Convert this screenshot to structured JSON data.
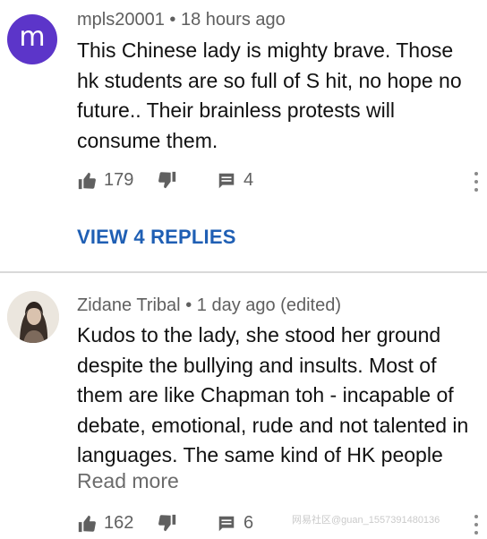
{
  "comments": [
    {
      "avatar_letter": "m",
      "avatar_color": "#5c35c9",
      "author": "mpls20001",
      "time": "18 hours ago",
      "text": "This Chinese lady is mighty brave. Those hk students are so full of S hit, no hope no future.. Their brainless protests will consume them.",
      "likes": "179",
      "replies": "4",
      "view_replies_label": "VIEW 4 REPLIES"
    },
    {
      "avatar_icon": "profile-photo",
      "author": "Zidane Tribal",
      "time": "1 day ago (edited)",
      "text": "Kudos to the lady, she stood her ground despite the bullying and insults. Most of them are like Chapman toh - incapable of debate, emotional, rude and not talented in languages. The same kind of HK people",
      "read_more_label": "Read more",
      "likes": "162",
      "replies": "6"
    }
  ],
  "meta_separator": "•",
  "watermark": "网易社区@guan_1557391480136",
  "colors": {
    "link": "#1f5fb4",
    "meta": "#5f5f5f",
    "divider": "#d9d9d9"
  }
}
